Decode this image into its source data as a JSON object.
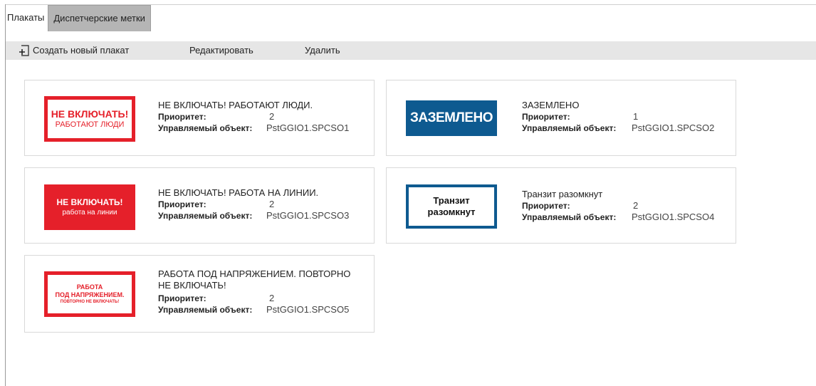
{
  "tabs": [
    {
      "label": "Плакаты",
      "active": false
    },
    {
      "label": "Диспетчерские метки",
      "active": true
    }
  ],
  "toolbar": {
    "create_label": "Создать новый плакат",
    "edit_label": "Редактировать",
    "delete_label": "Удалить"
  },
  "field_labels": {
    "priority": "Приоритет:",
    "object": "Управляемый объект:"
  },
  "posters": [
    {
      "title": "НЕ ВКЛЮЧАТЬ! РАБОТАЮТ ЛЮДИ.",
      "priority": "2",
      "object": "PstGGIO1.SPCSO1",
      "image": {
        "line1": "НЕ ВКЛЮЧАТЬ!",
        "line2": "РАБОТАЮТ ЛЮДИ",
        "style": "red-frame",
        "color": "#e5202a"
      }
    },
    {
      "title": "ЗАЗЕМЛЕНО",
      "priority": "1",
      "object": "PstGGIO1.SPCSO2",
      "image": {
        "line1": "ЗАЗЕМЛЕНО",
        "style": "blue-fill",
        "color": "#0e5a90"
      }
    },
    {
      "title": "НЕ ВКЛЮЧАТЬ! РАБОТА НА ЛИНИИ.",
      "priority": "2",
      "object": "PstGGIO1.SPCSO3",
      "image": {
        "line1": "НЕ ВКЛЮЧАТЬ!",
        "line2": "работа на линии",
        "style": "red-fill",
        "color": "#e5202a"
      }
    },
    {
      "title": "Транзит разомкнут",
      "priority": "2",
      "object": "PstGGIO1.SPCSO4",
      "image": {
        "line1": "Транзит",
        "line2": "разомкнут",
        "style": "blue-frame",
        "color": "#0e5a90"
      }
    },
    {
      "title_line1": "РАБОТА ПОД НАПРЯЖЕНИЕМ. ПОВТОРНО",
      "title_line2": "НЕ ВКЛЮЧАТЬ!",
      "priority": "2",
      "object": "PstGGIO1.SPCSO5",
      "image": {
        "line1": "РАБОТА",
        "line2": "ПОД НАПРЯЖЕНИЕМ.",
        "line3": "ПОВТОРНО НЕ ВКЛЮЧАТЬ!",
        "style": "red-frame",
        "color": "#e5202a"
      }
    }
  ]
}
